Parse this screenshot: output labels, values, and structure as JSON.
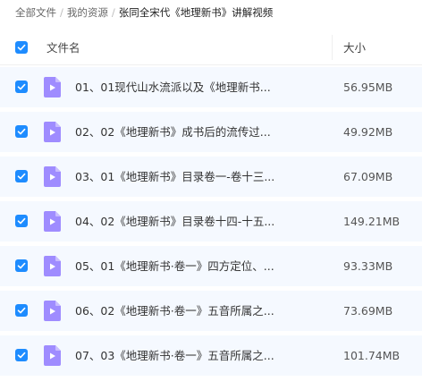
{
  "breadcrumb": {
    "items": [
      "全部文件",
      "我的资源",
      "张同全宋代《地理新书》讲解视频"
    ],
    "separator": "/"
  },
  "header": {
    "name_label": "文件名",
    "size_label": "大小",
    "select_all_checked": true
  },
  "colors": {
    "accent": "#1e8cff",
    "video_icon": "#9f8cff",
    "row_selected_bg": "#f5f9ff"
  },
  "files": [
    {
      "name": "01、01现代山水流派以及《地理新书...",
      "size": "56.95MB",
      "checked": true,
      "icon": "video-file-icon"
    },
    {
      "name": "02、02《地理新书》成书后的流传过...",
      "size": "49.92MB",
      "checked": true,
      "icon": "video-file-icon"
    },
    {
      "name": "03、01《地理新书》目录卷一-卷十三...",
      "size": "67.09MB",
      "checked": true,
      "icon": "video-file-icon"
    },
    {
      "name": "04、02《地理新书》目录卷十四-十五...",
      "size": "149.21MB",
      "checked": true,
      "icon": "video-file-icon"
    },
    {
      "name": "05、01《地理新书·卷一》四方定位、...",
      "size": "93.33MB",
      "checked": true,
      "icon": "video-file-icon"
    },
    {
      "name": "06、02《地理新书·卷一》五音所属之...",
      "size": "73.69MB",
      "checked": true,
      "icon": "video-file-icon"
    },
    {
      "name": "07、03《地理新书·卷一》五音所属之...",
      "size": "101.74MB",
      "checked": true,
      "icon": "video-file-icon"
    }
  ]
}
